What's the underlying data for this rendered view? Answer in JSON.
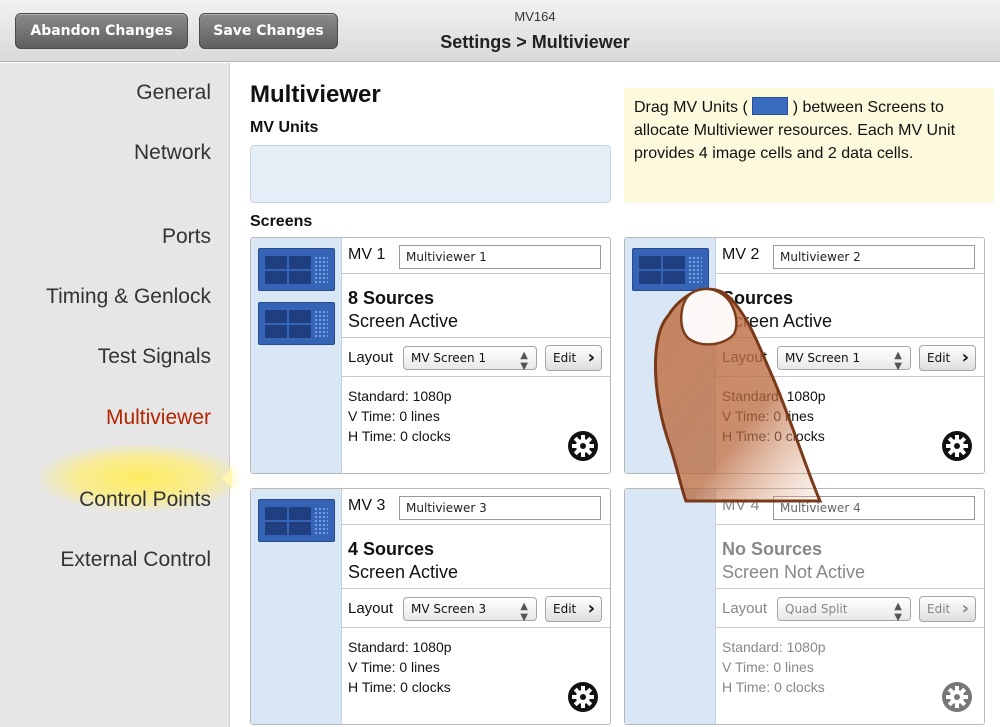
{
  "toolbar": {
    "abandon_label": "Abandon Changes",
    "save_label": "Save Changes",
    "device": "MV164",
    "breadcrumb": "Settings > Multiviewer"
  },
  "sidebar": {
    "items": [
      {
        "label": "General"
      },
      {
        "label": "Network"
      },
      {
        "label": "Ports"
      },
      {
        "label": "Timing & Genlock"
      },
      {
        "label": "Test Signals"
      },
      {
        "label": "Multiviewer"
      },
      {
        "label": "Control Points"
      },
      {
        "label": "External Control"
      }
    ],
    "active": "Multiviewer"
  },
  "main": {
    "title": "Multiviewer",
    "units_label": "MV Units",
    "screens_label": "Screens",
    "hint_pre": "Drag MV Units (",
    "hint_post": ") between Screens to allocate Multiviewer resources. Each MV Unit provides 4 image cells and 2 data cells."
  },
  "screens": [
    {
      "label": "MV 1",
      "name": "Multiviewer 1",
      "sources": "8 Sources",
      "status": "Screen Active",
      "layout_label": "Layout",
      "layout": "MV Screen 1",
      "edit": "Edit",
      "standard": "Standard: 1080p",
      "vtime": "V Time: 0 lines",
      "htime": "H Time: 0 clocks",
      "units": 2
    },
    {
      "label": "MV 2",
      "name": "Multiviewer 2",
      "sources": "Sources",
      "status": "Screen Active",
      "layout_label": "Layout",
      "layout": "MV Screen 1",
      "edit": "Edit",
      "standard": "Standard: 1080p",
      "vtime": "V Time: 0 lines",
      "htime": "H Time: 0 clocks",
      "units": 1
    },
    {
      "label": "MV 3",
      "name": "Multiviewer 3",
      "sources": "4 Sources",
      "status": "Screen Active",
      "layout_label": "Layout",
      "layout": "MV Screen 3",
      "edit": "Edit",
      "standard": "Standard: 1080p",
      "vtime": "V Time: 0 lines",
      "htime": "H Time: 0 clocks",
      "units": 1
    },
    {
      "label": "MV 4",
      "name": "Multiviewer 4",
      "sources": "No Sources",
      "status": "Screen Not Active",
      "layout_label": "Layout",
      "layout": "Quad Split",
      "edit": "Edit",
      "standard": "Standard: 1080p",
      "vtime": "V Time: 0 lines",
      "htime": "H Time: 0 clocks",
      "units": 0
    }
  ],
  "colors": {
    "accent_active": "#b32400",
    "unit_blue": "#3564b6",
    "hint_bg": "#fdf9dc"
  },
  "icons": {
    "settings": "gear-icon",
    "drag_gesture": "finger-icon"
  }
}
